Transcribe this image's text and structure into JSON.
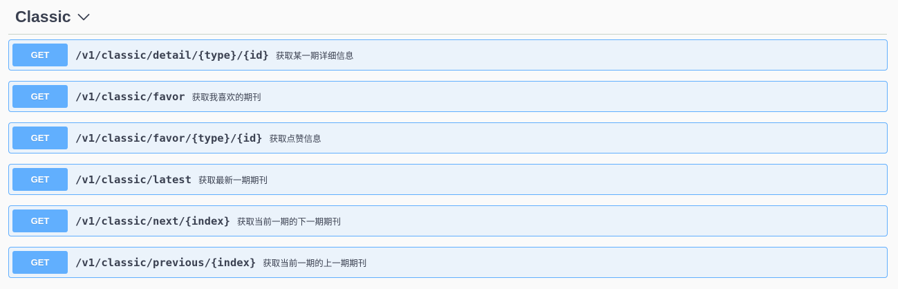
{
  "section": {
    "title": "Classic",
    "chevron_icon": "chevron-down-icon"
  },
  "colors": {
    "get_accent": "#61affe",
    "op_background": "#ebf3fb",
    "text": "#3b4151"
  },
  "operations": [
    {
      "method": "GET",
      "path": "/v1/classic/detail/{type}/{id}",
      "summary": "获取某一期详细信息"
    },
    {
      "method": "GET",
      "path": "/v1/classic/favor",
      "summary": "获取我喜欢的期刊"
    },
    {
      "method": "GET",
      "path": "/v1/classic/favor/{type}/{id}",
      "summary": "获取点赞信息"
    },
    {
      "method": "GET",
      "path": "/v1/classic/latest",
      "summary": "获取最新一期期刊"
    },
    {
      "method": "GET",
      "path": "/v1/classic/next/{index}",
      "summary": "获取当前一期的下一期期刊"
    },
    {
      "method": "GET",
      "path": "/v1/classic/previous/{index}",
      "summary": "获取当前一期的上一期期刊"
    }
  ]
}
